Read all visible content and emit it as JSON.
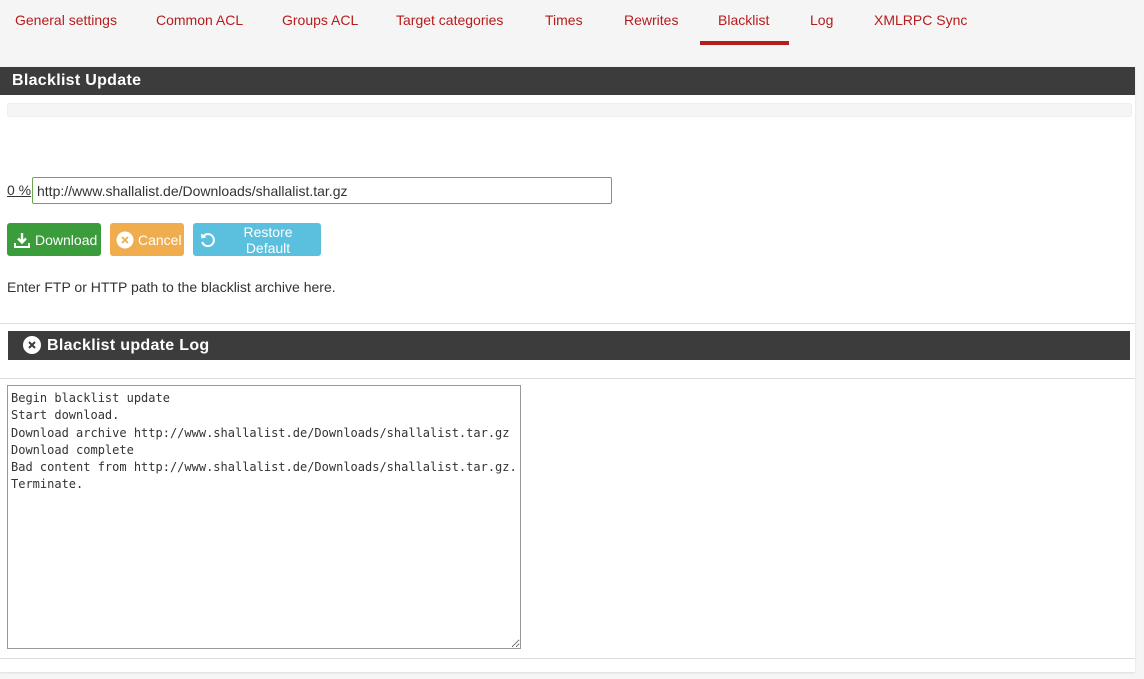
{
  "tabs": [
    {
      "label": "General settings",
      "active": false
    },
    {
      "label": "Common ACL",
      "active": false
    },
    {
      "label": "Groups ACL",
      "active": false
    },
    {
      "label": "Target categories",
      "active": false
    },
    {
      "label": "Times",
      "active": false
    },
    {
      "label": "Rewrites",
      "active": false
    },
    {
      "label": "Blacklist",
      "active": true
    },
    {
      "label": "Log",
      "active": false
    },
    {
      "label": "XMLRPC Sync",
      "active": false
    }
  ],
  "update_panel": {
    "title": "Blacklist Update",
    "progress_percent": 0,
    "progress_label": "0 %",
    "url_value": "http://www.shallalist.de/Downloads/shallalist.tar.gz",
    "buttons": {
      "download": "Download",
      "cancel": "Cancel",
      "restore": "Restore Default"
    },
    "help_text": "Enter FTP or HTTP path to the blacklist archive here."
  },
  "log_panel": {
    "title": "Blacklist update Log",
    "log_text": "Begin blacklist update\nStart download.\nDownload archive http://www.shallalist.de/Downloads/shallalist.tar.gz\nDownload complete\nBad content from http://www.shallalist.de/Downloads/shallalist.tar.gz.\nTerminate."
  },
  "colors": {
    "accent": "#b71c1c",
    "heading_bg": "#3c3c3c",
    "download_btn": "#3a9c3a",
    "cancel_btn": "#f0ad4e",
    "restore_btn": "#5bc0de"
  }
}
